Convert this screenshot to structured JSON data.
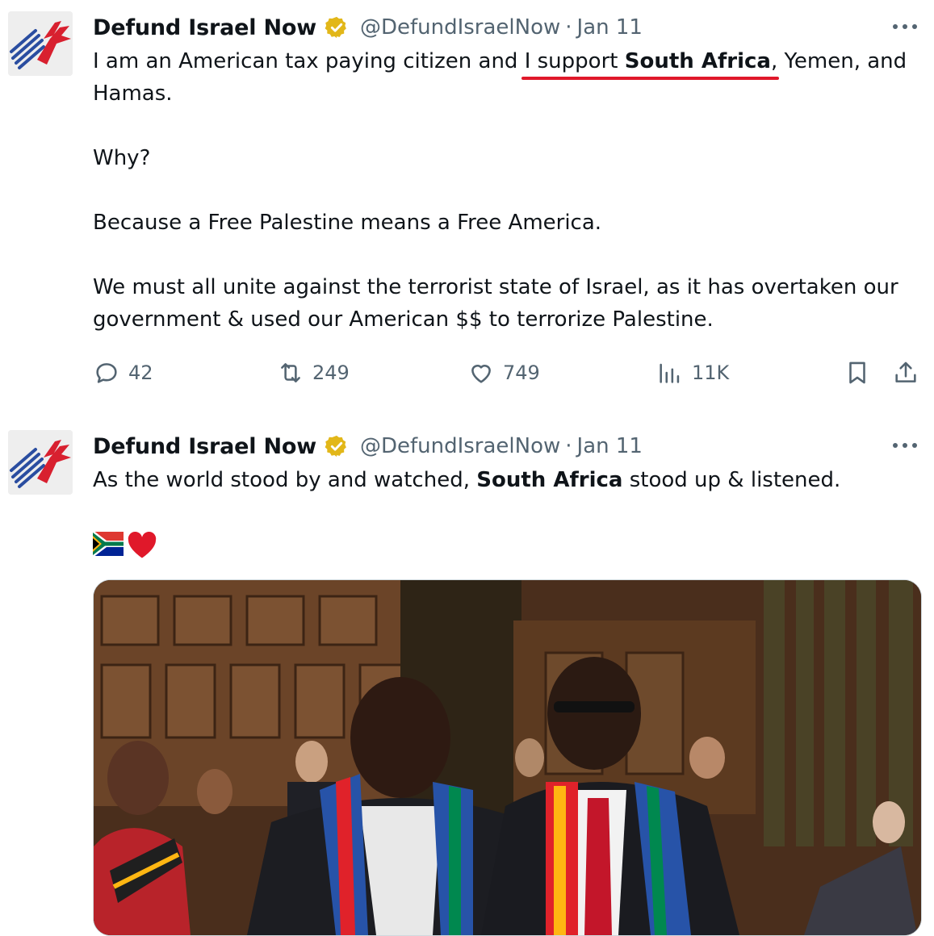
{
  "tweets": [
    {
      "author": "Defund Israel Now",
      "handle": "@DefundIsraelNow",
      "date": "Jan 11",
      "separator": "·",
      "text_part1": "I am an American tax paying citizen and ",
      "text_underlined_pre": "I support ",
      "text_bold": "South Africa",
      "text_part2": ", Yemen, and\nHamas.\n\nWhy?\n\nBecause a Free Palestine means a Free America.\n\nWe must all unite against the terrorist state of Israel, as it has overtaken our\ngovernment & used our American $$ to terrorize Palestine.",
      "stats": {
        "replies": "42",
        "retweets": "249",
        "likes": "749",
        "views": "11K"
      }
    },
    {
      "author": "Defund Israel Now",
      "handle": "@DefundIsraelNow",
      "date": "Jan 11",
      "separator": "·",
      "text_part1": "As the world stood by and watched, ",
      "text_bold": "South Africa",
      "text_part2": " stood up & listened.",
      "emojis": [
        "south-africa-flag",
        "red-heart"
      ]
    }
  ],
  "colors": {
    "text": "#0f1419",
    "secondary": "#536471",
    "underline": "#e0182a",
    "verified_badge": "#e2b719"
  }
}
